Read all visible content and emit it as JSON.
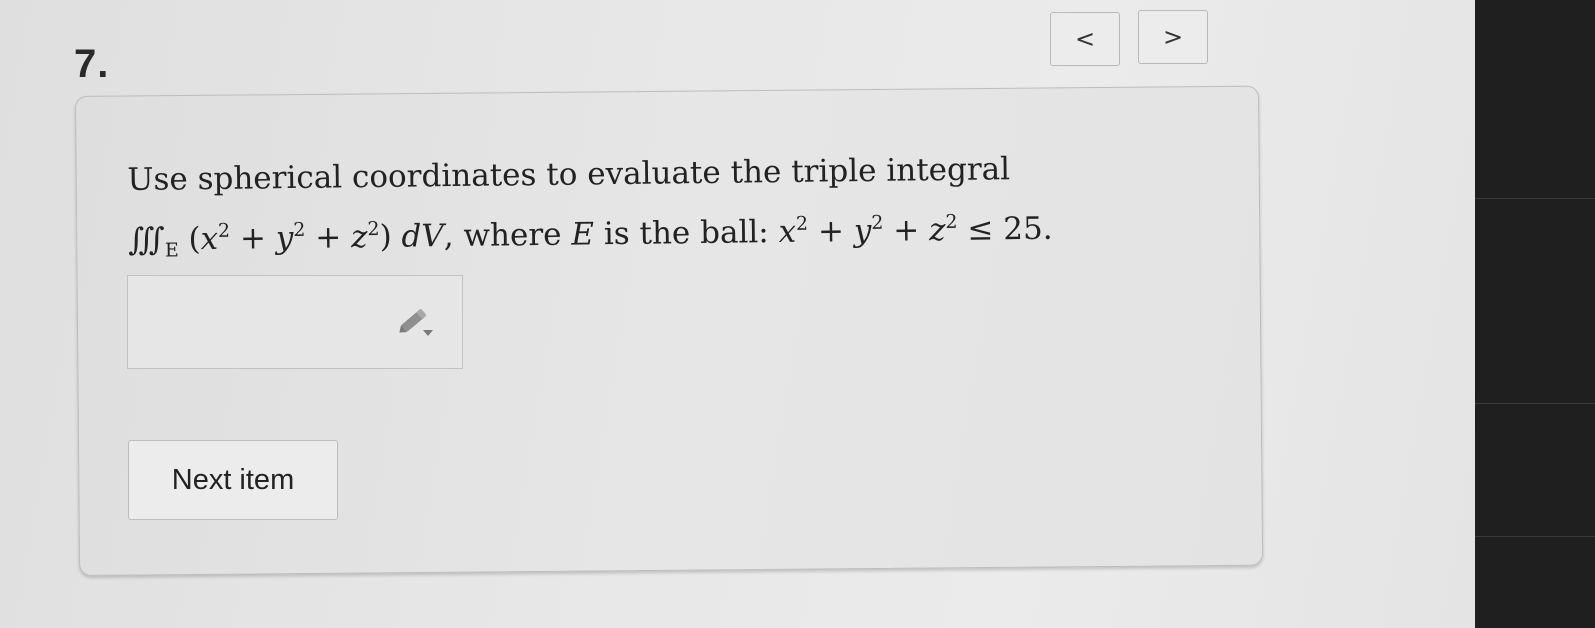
{
  "question": {
    "number": "7.",
    "line1": "Use spherical coordinates to evaluate the triple integral",
    "line2_parts": {
      "integral_symbol": "∭",
      "integral_subscript": "E",
      "integrand_open": "(",
      "x": "x",
      "exp1": "2",
      "plus1": " + ",
      "y": "y",
      "exp2": "2",
      "plus2": " + ",
      "z": "z",
      "exp3": "2",
      "integrand_close": ")",
      "differential": "dV",
      "comma_where": ", where ",
      "region": "E",
      "is_the_ball": " is the ball: ",
      "bx": "x",
      "bexp1": "2",
      "bplus1": " + ",
      "by": "y",
      "bexp2": "2",
      "bplus2": " + ",
      "bz": "z",
      "bexp3": "2",
      "leq": " ≤ ",
      "radius_sq": "25."
    }
  },
  "navigation": {
    "prev_glyph": "<",
    "next_glyph": ">"
  },
  "answer": {
    "value": "",
    "icon": "pencil-edit-icon"
  },
  "buttons": {
    "next_item_label": "Next item"
  }
}
